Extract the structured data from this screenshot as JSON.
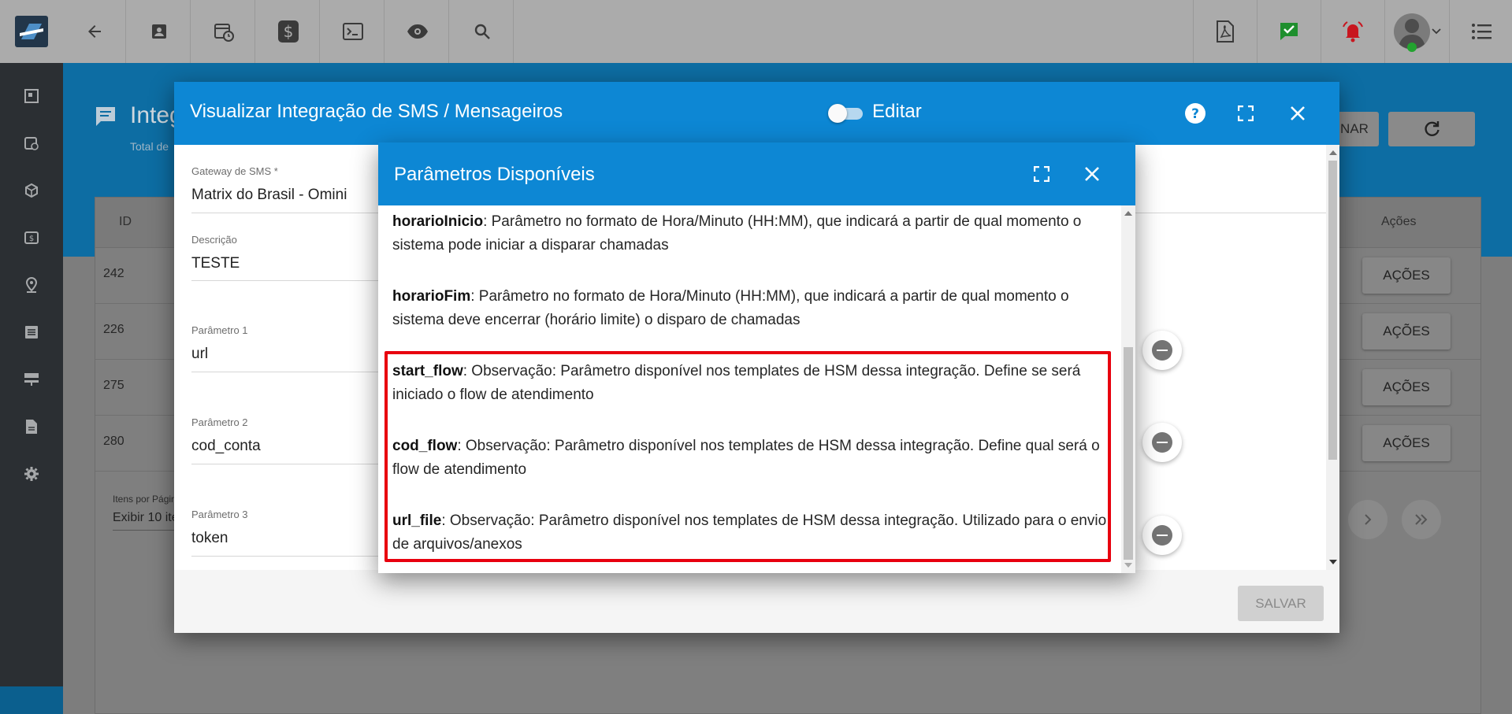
{
  "topbar": {
    "icons": [
      "back-arrow-icon",
      "contact-icon",
      "calendar-clock-icon",
      "dollar-icon",
      "terminal-icon",
      "eye-icon",
      "search-icon",
      "pdf-icon",
      "check-message-icon",
      "alarm-icon",
      "avatar",
      "menu-icon"
    ]
  },
  "background_page": {
    "title": "Integ",
    "subtitle": "Total de",
    "header_button_1": "NAR",
    "table": {
      "col_id": "ID",
      "col_acoes": "Ações",
      "rows": [
        {
          "id": "242",
          "action": "AÇÕES"
        },
        {
          "id": "226",
          "action": "AÇÕES"
        },
        {
          "id": "275",
          "action": "AÇÕES"
        },
        {
          "id": "280",
          "action": "AÇÕES"
        }
      ]
    },
    "pager": {
      "label": "Itens por Págin",
      "select": "Exibir 10 ite"
    }
  },
  "modal": {
    "title": "Visualizar Integração de SMS / Mensageiros",
    "toggle_label": "Editar",
    "fields": [
      {
        "label": "Gateway de SMS *",
        "value": "Matrix do Brasil - Omini"
      },
      {
        "label": "Descrição",
        "value": "TESTE"
      },
      {
        "label": "Parâmetro 1",
        "value": "url"
      },
      {
        "label": "Parâmetro 2",
        "value": "cod_conta"
      },
      {
        "label": "Parâmetro 3",
        "value": "token"
      }
    ],
    "save_label": "SALVAR"
  },
  "dialog": {
    "title": "Parâmetros Disponíveis",
    "params": [
      {
        "name": "horarioInicio",
        "text": ": Parâmetro no formato de Hora/Minuto (HH:MM), que indicará a partir de qual momento o sistema pode iniciar a disparar chamadas"
      },
      {
        "name": "horarioFim",
        "text": ": Parâmetro no formato de Hora/Minuto (HH:MM), que indicará a partir de qual momento o sistema deve encerrar (horário limite) o disparo de chamadas"
      },
      {
        "name": "start_flow",
        "text": ": Observação: Parâmetro disponível nos templates de HSM dessa integração. Define se será iniciado o flow de atendimento"
      },
      {
        "name": "cod_flow",
        "text": ": Observação: Parâmetro disponível nos templates de HSM dessa integração. Define qual será o flow de atendimento"
      },
      {
        "name": "url_file",
        "text": ": Observação: Parâmetro disponível nos templates de HSM dessa integração. Utilizado para o envio de arquivos/anexos"
      }
    ]
  },
  "colors": {
    "header_blue": "#0d87d4",
    "highlight_red": "#e8000e"
  }
}
